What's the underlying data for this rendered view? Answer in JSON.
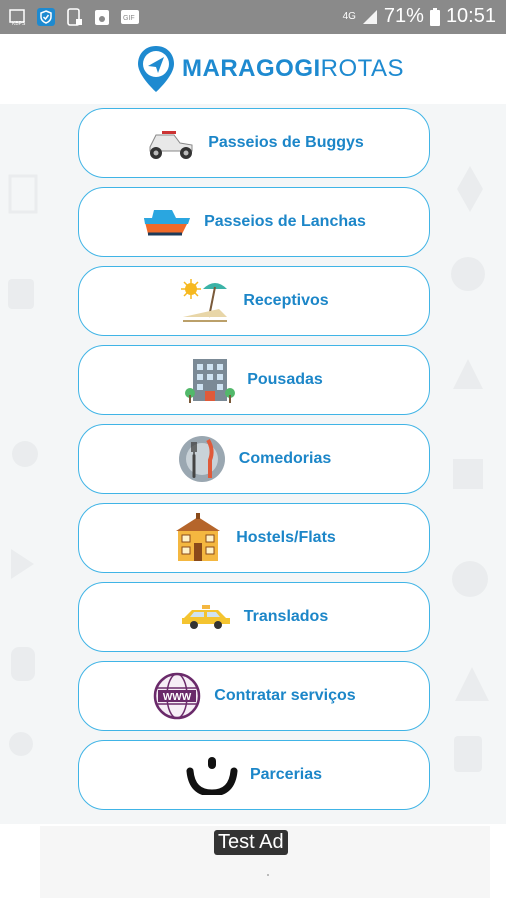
{
  "status_bar": {
    "network": "4G",
    "battery": "71%",
    "time": "10:51"
  },
  "app": {
    "brand_bold": "MARAGOGI",
    "brand_light": "ROTAS"
  },
  "menu": [
    {
      "label": "Passeios de Buggys",
      "icon": "buggy-icon"
    },
    {
      "label": "Passeios de Lanchas",
      "icon": "boat-icon"
    },
    {
      "label": "Receptivos",
      "icon": "beach-chair-icon"
    },
    {
      "label": "Pousadas",
      "icon": "hotel-building-icon"
    },
    {
      "label": "Comedorias",
      "icon": "plate-fork-knife-icon"
    },
    {
      "label": "Hostels/Flats",
      "icon": "house-icon"
    },
    {
      "label": "Translados",
      "icon": "taxi-icon"
    },
    {
      "label": "Contratar serviços",
      "icon": "www-globe-icon"
    },
    {
      "label": "Parcerias",
      "icon": "smile-icon"
    }
  ],
  "ad": {
    "badge": "Test Ad"
  },
  "colors": {
    "accent": "#1e8ad0",
    "button_border": "#40b4e6",
    "status_bar": "#8a8a8a"
  }
}
